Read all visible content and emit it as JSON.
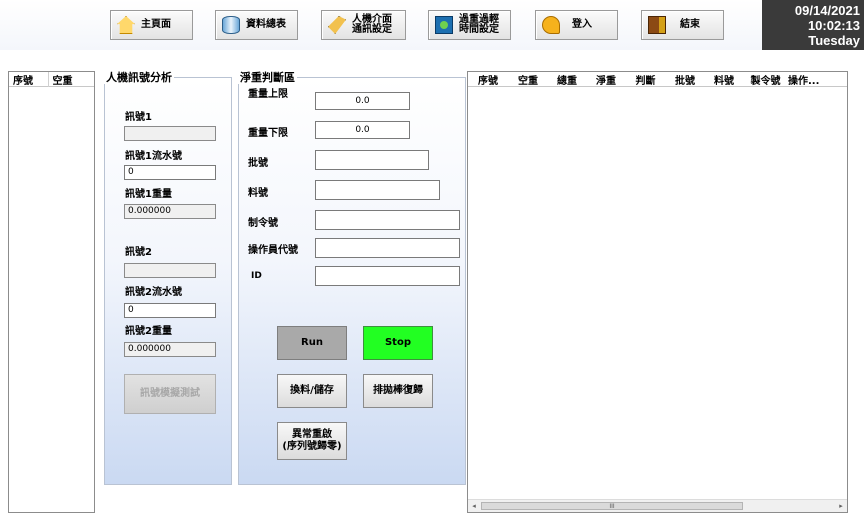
{
  "toolbar": {
    "buttons": [
      {
        "label": "主頁面",
        "icon": "home-icon"
      },
      {
        "label": "資料總表",
        "icon": "database-icon"
      },
      {
        "label": "人機介面\n通訊設定",
        "icon": "hmi-settings-icon"
      },
      {
        "label": "過重過輕\n時間設定",
        "icon": "timer-settings-icon"
      },
      {
        "label": "登入",
        "icon": "key-icon"
      },
      {
        "label": "結束",
        "icon": "exit-door-icon"
      }
    ]
  },
  "clock": {
    "date": "09/14/2021",
    "time": "10:02:13",
    "day": "Tuesday"
  },
  "left_list": {
    "columns": [
      "序號",
      "空重"
    ]
  },
  "barcode_panel": {
    "title": "人機訊號分析",
    "barcode1_label": "訊號1",
    "barcode1_value": "",
    "barcode1_serial_label": "訊號1流水號",
    "barcode1_serial_value": "0",
    "barcode1_weight_label": "訊號1重量",
    "barcode1_weight_value": "0.000000",
    "barcode2_label": "訊號2",
    "barcode2_value": "",
    "barcode2_serial_label": "訊號2流水號",
    "barcode2_serial_value": "0",
    "barcode2_weight_label": "訊號2重量",
    "barcode2_weight_value": "0.000000",
    "test_button": "訊號模擬測試"
  },
  "net_panel": {
    "title": "淨重判斷區",
    "upper_limit_label": "重量上限",
    "upper_limit_value": "0.0",
    "lower_limit_label": "重量下限",
    "lower_limit_value": "0.0",
    "batch_label": "批號",
    "batch_value": "",
    "material_label": "料號",
    "material_value": "",
    "order_label": "制令號",
    "order_value": "",
    "operator_label": "操作員代號",
    "operator_value": "",
    "id_label": "ID",
    "id_value": "",
    "run_button": "Run",
    "stop_button": "Stop",
    "save_button": "換料/儲存",
    "reset_button": "排拋棒復歸",
    "abnormal_button": "異常重啟\n(序列號歸零)"
  },
  "right_table": {
    "columns": [
      "序號",
      "空重",
      "總重",
      "淨重",
      "判斷",
      "批號",
      "料號",
      "製令號",
      "操作..."
    ],
    "scroll_thumb_label": "III"
  },
  "colors": {
    "stop_button": "#22ff22",
    "run_button": "#a9a9a9",
    "clock_bg": "#3a3a3a"
  }
}
